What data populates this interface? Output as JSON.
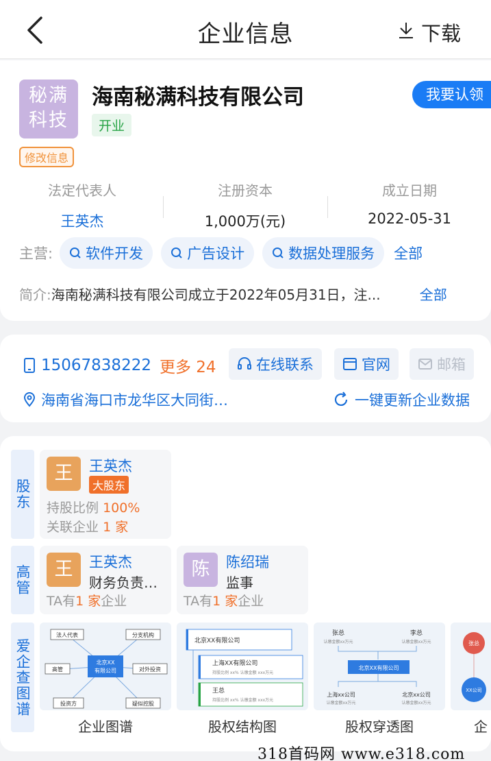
{
  "header": {
    "title": "企业信息",
    "download_label": "下载"
  },
  "company": {
    "logo_text_line1": "秘满",
    "logo_text_line2": "科技",
    "name": "海南秘满科技有限公司",
    "status": "开业",
    "claim_button": "我要认领",
    "edit_tag": "修改信息",
    "stats": [
      {
        "label": "法定代表人",
        "value": "王英杰"
      },
      {
        "label": "注册资本",
        "value": "1,000万(元)"
      },
      {
        "label": "成立日期",
        "value": "2022-05-31"
      }
    ],
    "business_label": "主营:",
    "business_chips": [
      "软件开发",
      "广告设计",
      "数据处理服务"
    ],
    "business_all": "全部",
    "intro_label": "简介:",
    "intro_text": "海南秘满科技有限公司成立于2022年05月31日，注...",
    "intro_all": "全部"
  },
  "contact": {
    "phone": "15067838222",
    "more": "更多 24",
    "online_contact": "在线联系",
    "website": "官网",
    "email": "邮箱",
    "address": "海南省海口市龙华区大同街…",
    "refresh": "一键更新企业数据"
  },
  "shareholders": {
    "tab_label": "股东",
    "items": [
      {
        "avatar_char": "王",
        "name": "王英杰",
        "badge": "大股东",
        "ratio_label": "持股比例",
        "ratio_value": "100%",
        "related_label": "关联企业",
        "related_value": "1 家"
      }
    ]
  },
  "executives": {
    "tab_label": "高管",
    "items": [
      {
        "avatar_char": "王",
        "name": "王英杰",
        "role": "财务负责…",
        "ta_prefix": "TA有",
        "ta_count": "1 家",
        "ta_suffix": "企业"
      },
      {
        "avatar_char": "陈",
        "name": "陈绍瑞",
        "role": "监事",
        "ta_prefix": "TA有",
        "ta_count": "1 家",
        "ta_suffix": "企业"
      }
    ]
  },
  "graphs": {
    "tab_label": "爱企查图谱",
    "items": [
      {
        "label": "企业图谱",
        "center": "北京XX",
        "center2": "有限公司",
        "nodes": [
          "法人代表",
          "分支机构",
          "高管",
          "对外投资",
          "投资方",
          "疑似控股"
        ]
      },
      {
        "label": "股权结构图",
        "company": "北京XX有限公司",
        "sub_company": "上海XX有限公司",
        "sub_meta": "持股比例  xx%    认缴金额  xxx万元",
        "person": "王总",
        "person_meta": "持股比例  xx%    认缴金额  xxx万元"
      },
      {
        "label": "股权穿透图",
        "top_left": "张总",
        "top_left_meta": "认缴金额xx万元",
        "top_right": "李总",
        "top_right_meta": "认缴金额xx万元",
        "center": "北京XX有限公司",
        "bottom_left": "上海xx公司",
        "bottom_left_meta": "认缴金额xx万元",
        "bottom_right": "北京xx公司",
        "bottom_right_meta": "认缴金额xx万元"
      },
      {
        "label": "企",
        "node1": "张总",
        "node2": "XX公司"
      }
    ]
  },
  "watermark": "318首码网  www.e318.com",
  "colors": {
    "accent": "#1a6fd8",
    "orange": "#f0702a",
    "green": "#27a345"
  }
}
